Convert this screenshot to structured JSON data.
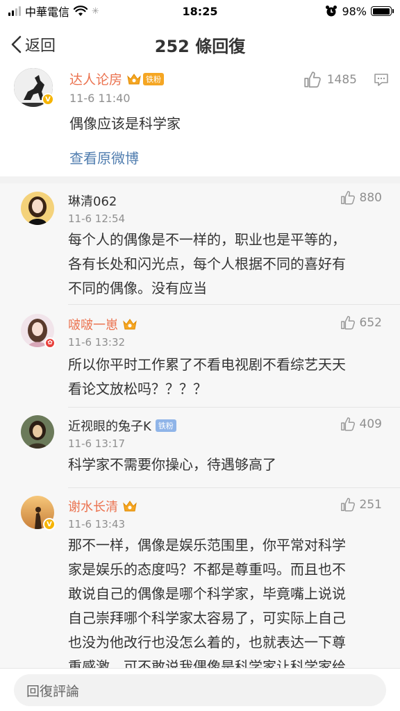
{
  "status_bar": {
    "carrier": "中華電信",
    "time": "18:25",
    "battery": "98%",
    "battery_level": 0.98
  },
  "nav": {
    "back_label": "返回",
    "title": "252 條回復"
  },
  "root_comment": {
    "user": "达人论房",
    "fan_label": "铁粉",
    "time": "11-6 11:40",
    "text": "偶像应该是科学家",
    "likes": "1485",
    "view_original": "查看原微博"
  },
  "replies": [
    {
      "user": "琳清062",
      "time": "11-6 12:54",
      "likes": "880",
      "lines": [
        "每个人的偶像是不一样的，职业也是平等的，",
        "各有长处和闪光点，每个人根据不同的喜好有",
        "不同的偶像。没有应当"
      ]
    },
    {
      "user": "啵啵一崽",
      "time": "11-6 13:32",
      "likes": "652",
      "lines": [
        "所以你平时工作累了不看电视剧不看综艺天天",
        "看论文放松吗？？？？"
      ]
    },
    {
      "user": "近视眼的兔子K",
      "fan_label": "铁粉",
      "time": "11-6 13:17",
      "likes": "409",
      "lines": [
        "科学家不需要你操心，待遇够高了"
      ]
    },
    {
      "user": "谢水长清",
      "time": "11-6 13:43",
      "likes": "251",
      "lines": [
        "那不一样，偶像是娱乐范围里，你平常对科学",
        "家是娱乐的态度吗？不都是尊重吗。而且也不",
        "敢说自己的偶像是哪个科学家，毕竟嘴上说说",
        "自己崇拜哪个科学家太容易了，可实际上自己",
        "也没为他改行也没怎么着的，也就表达一下尊",
        "重感激，可不敢说我偶像是科学家让科学家给"
      ]
    }
  ],
  "bottom": {
    "placeholder": "回復評論"
  },
  "colors": {
    "accent_orange": "#eb7350",
    "link_blue": "#507daf",
    "muted_gray": "#8f8f8f"
  }
}
